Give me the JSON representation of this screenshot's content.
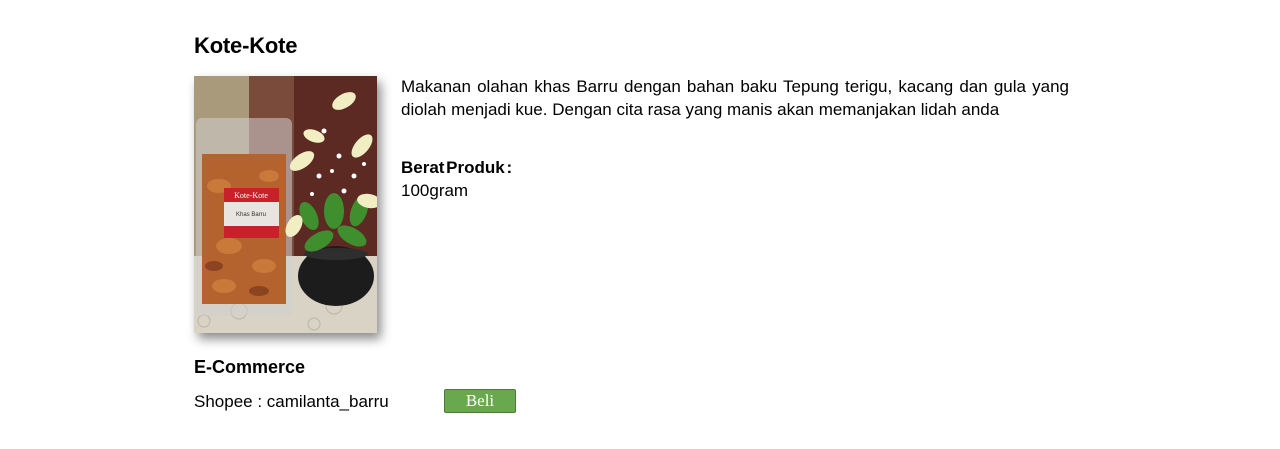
{
  "product": {
    "title": "Kote-Kote",
    "description": "Makanan olahan khas Barru dengan bahan baku Tepung terigu, kacang dan gula yang diolah menjadi kue. Dengan cita rasa yang manis akan memanjakan lidah anda",
    "weight_label": "Berat Produk :",
    "weight_value": "100gram",
    "package_label_top": "Kote-Kote",
    "package_label_bottom": "Khas Barru"
  },
  "ecommerce": {
    "heading": "E-Commerce",
    "shops": [
      {
        "platform": "Shopee",
        "separator": " : ",
        "account": "camilanta_barru",
        "button_label": "Beli"
      }
    ]
  },
  "colors": {
    "button_bg": "#6aa84f",
    "button_text": "#ffffff",
    "text": "#000000"
  }
}
